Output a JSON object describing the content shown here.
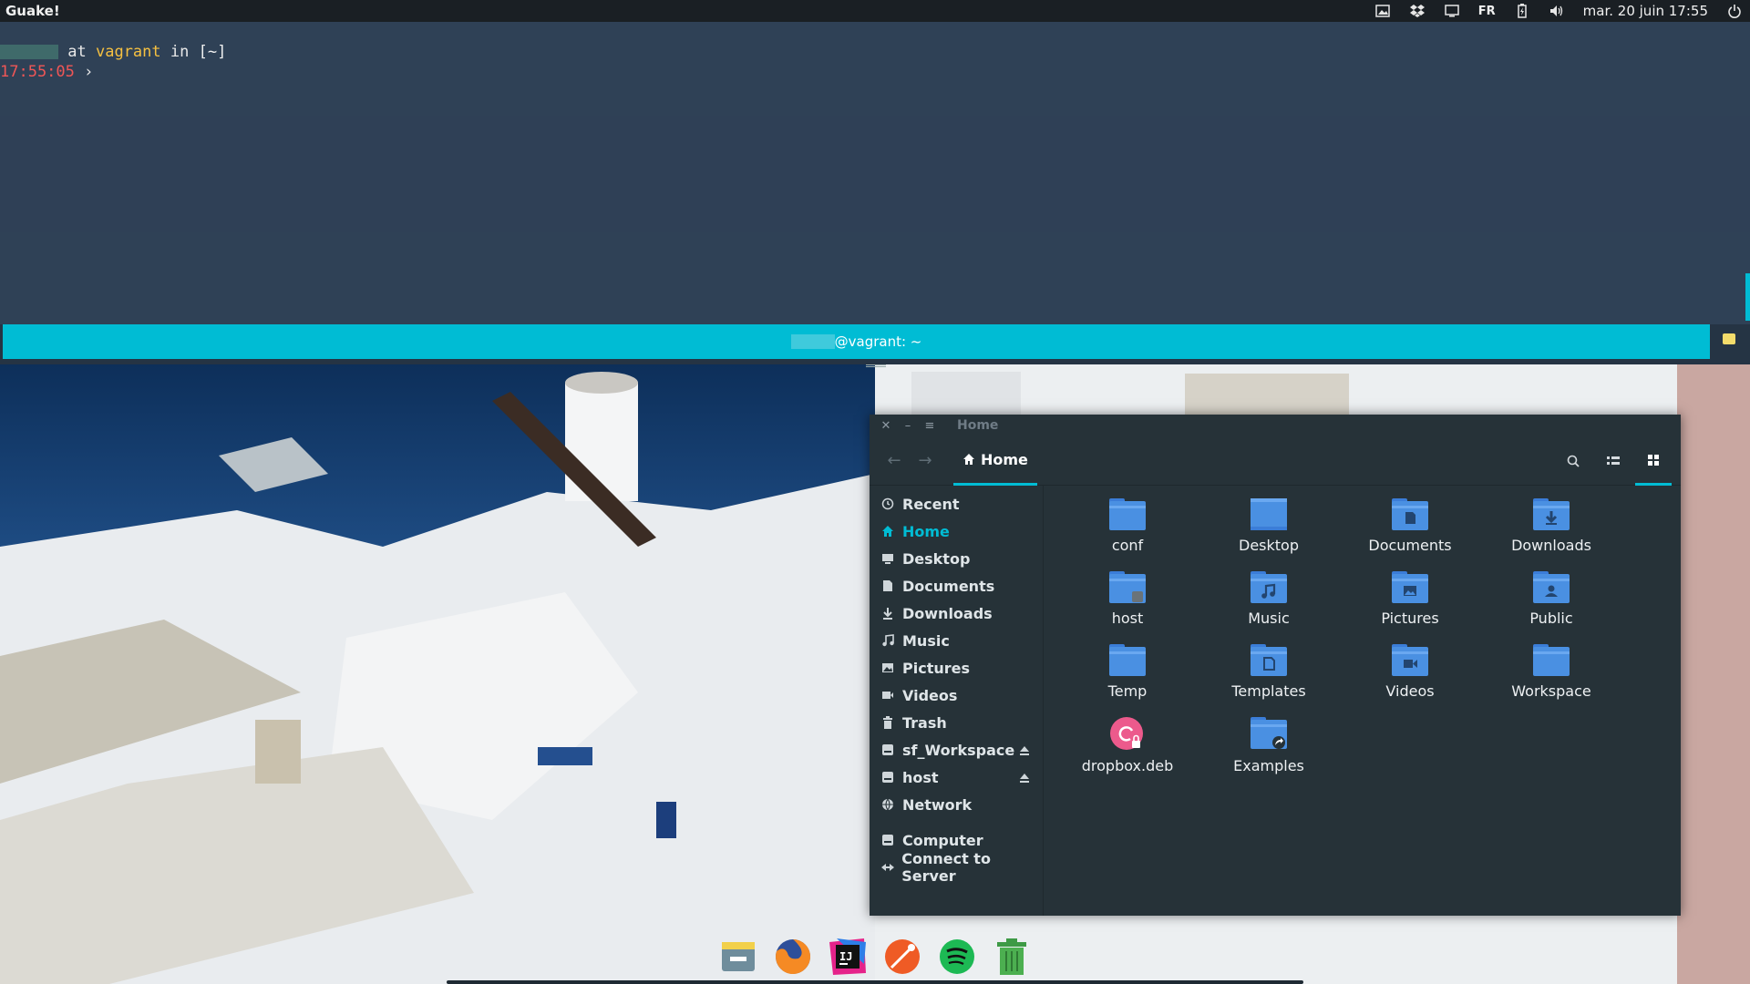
{
  "top_panel": {
    "app_name": "Guake!",
    "language": "FR",
    "clock": "mar. 20 juin 17:55",
    "tray_icons": [
      "image-viewer-icon",
      "dropbox-icon",
      "display-icon",
      "language-indicator",
      "battery-icon",
      "volume-icon",
      "power-icon"
    ]
  },
  "terminal": {
    "line1": {
      "at": "at",
      "host": "vagrant",
      "in": "in",
      "dir": "[~]"
    },
    "line2": {
      "time": "17:55:05",
      "prompt": "›"
    },
    "tab_title": "@vagrant: ~"
  },
  "files": {
    "window_title": "Home",
    "path_button": "Home",
    "sidebar": [
      {
        "label": "Recent",
        "icon": "clock-icon"
      },
      {
        "label": "Home",
        "icon": "home-icon",
        "active": true
      },
      {
        "label": "Desktop",
        "icon": "desktop-icon"
      },
      {
        "label": "Documents",
        "icon": "document-icon"
      },
      {
        "label": "Downloads",
        "icon": "download-icon"
      },
      {
        "label": "Music",
        "icon": "music-icon"
      },
      {
        "label": "Pictures",
        "icon": "picture-icon"
      },
      {
        "label": "Videos",
        "icon": "video-icon"
      },
      {
        "label": "Trash",
        "icon": "trash-icon"
      },
      {
        "label": "sf_Workspace",
        "icon": "drive-icon",
        "eject": true
      },
      {
        "label": "host",
        "icon": "drive-icon",
        "eject": true
      },
      {
        "label": "Network",
        "icon": "network-icon"
      },
      {
        "label": "Computer",
        "icon": "computer-icon"
      },
      {
        "label": "Connect to Server",
        "icon": "connect-icon"
      }
    ],
    "items": [
      {
        "name": "conf",
        "kind": "folder"
      },
      {
        "name": "Desktop",
        "kind": "folder-desktop"
      },
      {
        "name": "Documents",
        "kind": "folder-documents"
      },
      {
        "name": "Downloads",
        "kind": "folder-downloads"
      },
      {
        "name": "host",
        "kind": "folder-link"
      },
      {
        "name": "Music",
        "kind": "folder-music"
      },
      {
        "name": "Pictures",
        "kind": "folder-pictures"
      },
      {
        "name": "Public",
        "kind": "folder-public"
      },
      {
        "name": "Temp",
        "kind": "folder"
      },
      {
        "name": "Templates",
        "kind": "folder-templates"
      },
      {
        "name": "Videos",
        "kind": "folder-videos"
      },
      {
        "name": "Workspace",
        "kind": "folder"
      },
      {
        "name": "dropbox.deb",
        "kind": "debian-package"
      },
      {
        "name": "Examples",
        "kind": "folder-shared"
      }
    ]
  },
  "dock": [
    "file-manager-icon",
    "firefox-icon",
    "intellij-icon",
    "postman-icon",
    "spotify-icon",
    "trash-icon"
  ],
  "colors": {
    "accent": "#00bcd4",
    "terminal_bg": "#283a50",
    "folder_blue": "#4a90e2",
    "window_bg": "#263238"
  }
}
